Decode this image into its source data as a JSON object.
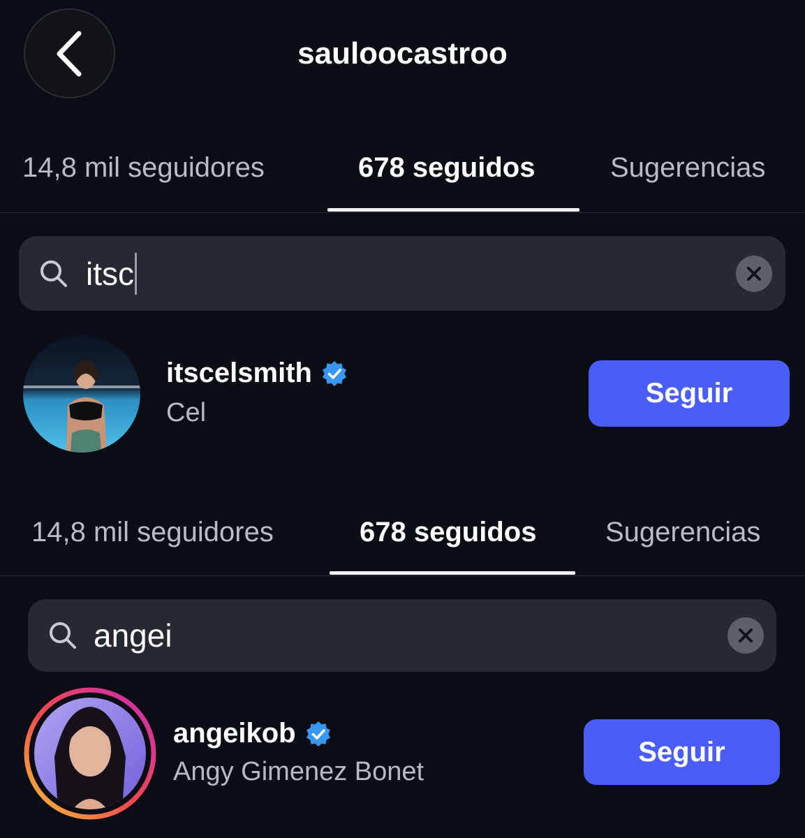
{
  "header": {
    "title": "sauloocastroo",
    "back_icon": "chevron-left-icon"
  },
  "tabs_top": [
    {
      "label": "14,8 mil seguidores",
      "active": false
    },
    {
      "label": "678 seguidos",
      "active": true
    },
    {
      "label": "Sugerencias",
      "active": false
    }
  ],
  "search_top": {
    "value": "itsc",
    "icon": "search-icon",
    "clear_icon": "close-icon"
  },
  "result_top": {
    "username": "itscelsmith",
    "full_name": "Cel",
    "verified": true,
    "button_label": "Seguir"
  },
  "tabs_bottom": [
    {
      "label": "14,8 mil seguidores",
      "active": false
    },
    {
      "label": "678 seguidos",
      "active": true
    },
    {
      "label": "Sugerencias",
      "active": false
    }
  ],
  "search_bottom": {
    "value": "angei",
    "icon": "search-icon",
    "clear_icon": "close-icon"
  },
  "result_bottom": {
    "username": "angeikob",
    "full_name": "Angy Gimenez Bonet",
    "verified": true,
    "has_story_ring": true,
    "button_label": "Seguir"
  },
  "colors": {
    "background": "#0b0d14",
    "button": "#4a5df9",
    "verified": "#3897f0",
    "search_bg": "#26292f"
  }
}
